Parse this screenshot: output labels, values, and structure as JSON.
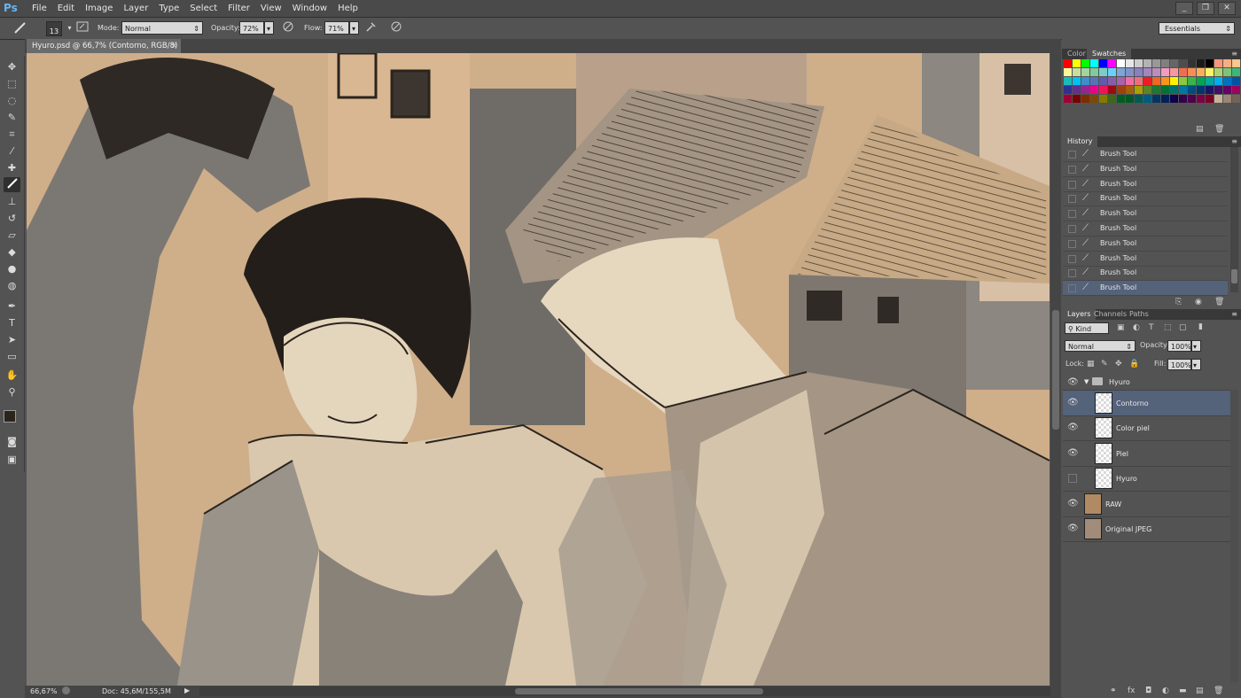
{
  "app": {
    "logo": "Ps",
    "window_buttons": [
      "_",
      "❐",
      "✕"
    ]
  },
  "menu": [
    "File",
    "Edit",
    "Image",
    "Layer",
    "Type",
    "Select",
    "Filter",
    "View",
    "Window",
    "Help"
  ],
  "options": {
    "brush_size": "13",
    "mode_label": "Mode:",
    "mode_value": "Normal",
    "opacity_label": "Opacity:",
    "opacity_value": "72%",
    "flow_label": "Flow:",
    "flow_value": "71%"
  },
  "workspace": "Essentials",
  "document": {
    "tab_title": "Hyuro.psd @ 66,7% (Contorno, RGB/8) *",
    "zoom": "66,67%",
    "doc_size": "Doc: 45,6M/155,5M"
  },
  "color_panel": {
    "tabs": [
      "Color",
      "Swatches"
    ],
    "active_tab": "Swatches",
    "swatches": [
      "#ff0000",
      "#ffff00",
      "#00ff00",
      "#00ffff",
      "#0000ff",
      "#ff00ff",
      "#ffffff",
      "#e6e6e6",
      "#cccccc",
      "#b3b3b3",
      "#999999",
      "#808080",
      "#666666",
      "#4d4d4d",
      "#333333",
      "#1a1a1a",
      "#000000",
      "#f7977a",
      "#fbad82",
      "#fdc68c",
      "#fff799",
      "#c6df9c",
      "#a4d49d",
      "#81ca9d",
      "#7bcdc8",
      "#6ccff7",
      "#7ca6d8",
      "#8293ca",
      "#8881be",
      "#a286bd",
      "#bc8cbf",
      "#f49bc1",
      "#f5999d",
      "#f26c4f",
      "#f68e55",
      "#fbaf5a",
      "#fff467",
      "#acd372",
      "#7cc576",
      "#3bb878",
      "#1abbb4",
      "#00bff3",
      "#438cca",
      "#5574b9",
      "#605ca8",
      "#855fa8",
      "#a763a9",
      "#ef6ea8",
      "#f16d7e",
      "#ed1c24",
      "#f26522",
      "#f7941d",
      "#fff200",
      "#8dc63f",
      "#39b54a",
      "#00a651",
      "#00a99d",
      "#00aeef",
      "#0072bc",
      "#0054a6",
      "#2e3192",
      "#662d91",
      "#92278f",
      "#ec008c",
      "#ed145b",
      "#9e0b0f",
      "#a0410d",
      "#a3620a",
      "#aba000",
      "#598527",
      "#1a7b30",
      "#007236",
      "#00746b",
      "#0076a3",
      "#004b80",
      "#003471",
      "#1b1464",
      "#440e62",
      "#630460",
      "#9e005d",
      "#9e0039",
      "#790000",
      "#7b2e00",
      "#7d4900",
      "#827b00",
      "#406618",
      "#005e20",
      "#005826",
      "#005952",
      "#005b7f",
      "#003663",
      "#002157",
      "#0d004c",
      "#32004b",
      "#4b0049",
      "#7b0046",
      "#7a0026",
      "#c7b299",
      "#998675",
      "#736357"
    ]
  },
  "history_panel": {
    "title": "History",
    "items": [
      "Brush Tool",
      "Brush Tool",
      "Brush Tool",
      "Brush Tool",
      "Brush Tool",
      "Brush Tool",
      "Brush Tool",
      "Brush Tool",
      "Brush Tool",
      "Brush Tool"
    ],
    "selected_index": 9
  },
  "layers_panel": {
    "tabs": [
      "Layers",
      "Channels",
      "Paths"
    ],
    "active_tab": "Layers",
    "filter": "Kind",
    "blend_mode": "Normal",
    "opacity_label": "Opacity:",
    "opacity_value": "100%",
    "lock_label": "Lock:",
    "fill_label": "Fill:",
    "fill_value": "100%",
    "group": "Hyuro",
    "layers": [
      {
        "name": "Contorno",
        "visible": true,
        "selected": true
      },
      {
        "name": "Color piel",
        "visible": true,
        "selected": false
      },
      {
        "name": "Piel",
        "visible": true,
        "selected": false
      },
      {
        "name": "Hyuro",
        "visible": false,
        "selected": false
      },
      {
        "name": "RAW",
        "visible": true,
        "selected": false
      },
      {
        "name": "Original JPEG",
        "visible": true,
        "selected": false
      }
    ]
  }
}
